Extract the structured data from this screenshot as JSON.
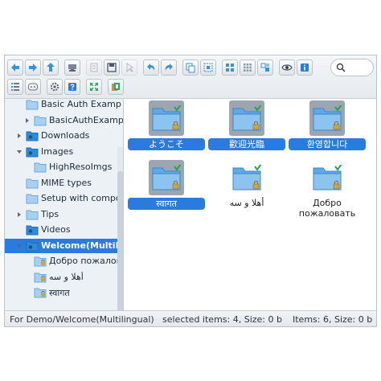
{
  "toolbar": {
    "buttons": [
      {
        "name": "back-button",
        "icon": "arrow-left-icon"
      },
      {
        "name": "forward-button",
        "icon": "arrow-right-icon"
      },
      {
        "name": "up-button",
        "icon": "arrow-up-icon"
      },
      {
        "name": "netmount-button",
        "icon": "drive-icon"
      },
      {
        "name": "open-button",
        "icon": "open-icon"
      },
      {
        "name": "save-button",
        "icon": "save-icon"
      },
      {
        "name": "select-button",
        "icon": "cursor-icon"
      },
      {
        "name": "undo-button",
        "icon": "undo-icon"
      },
      {
        "name": "redo-button",
        "icon": "redo-icon"
      },
      {
        "name": "copy-button",
        "icon": "copy-icon"
      },
      {
        "name": "select-all-button",
        "icon": "select-all-icon"
      },
      {
        "name": "view-icons-button",
        "icon": "grid-large-icon"
      },
      {
        "name": "view-small-icons-button",
        "icon": "grid-small-icon"
      },
      {
        "name": "view-tiles-button",
        "icon": "tiles-icon"
      },
      {
        "name": "preview-button",
        "icon": "eye-icon"
      },
      {
        "name": "info-button",
        "icon": "info-icon"
      },
      {
        "name": "view-list-button",
        "icon": "list-icon"
      },
      {
        "name": "sort-button",
        "icon": "sort-icon"
      },
      {
        "name": "settings-button",
        "icon": "gear-icon"
      },
      {
        "name": "help-button",
        "icon": "help-icon"
      },
      {
        "name": "fullscreen-button",
        "icon": "fullscreen-icon"
      },
      {
        "name": "extract-button",
        "icon": "archive-icon"
      }
    ],
    "search": {
      "value": "",
      "placeholder": ""
    }
  },
  "tree": {
    "items": [
      {
        "label": "Basic Auth Examp",
        "indent": 1,
        "arrow": "none",
        "icon": "folder-icon"
      },
      {
        "label": "BasicAuthExamp",
        "indent": 2,
        "arrow": "right",
        "icon": "folder-icon"
      },
      {
        "label": "Downloads",
        "indent": 1,
        "arrow": "right",
        "icon": "folder-dark-icon"
      },
      {
        "label": "Images",
        "indent": 1,
        "arrow": "down",
        "icon": "folder-dark-icon"
      },
      {
        "label": "HighResoImgs",
        "indent": 2,
        "arrow": "none",
        "icon": "folder-icon"
      },
      {
        "label": "MIME types",
        "indent": 1,
        "arrow": "none",
        "icon": "folder-icon"
      },
      {
        "label": "Setup with compo",
        "indent": 1,
        "arrow": "none",
        "icon": "folder-icon"
      },
      {
        "label": "Tips",
        "indent": 1,
        "arrow": "right",
        "icon": "folder-icon"
      },
      {
        "label": "Videos",
        "indent": 1,
        "arrow": "none",
        "icon": "folder-dark-icon"
      },
      {
        "label": "Welcome(Multilingu",
        "indent": 1,
        "arrow": "down",
        "icon": "folder-dark-icon",
        "selected": true
      },
      {
        "label": "Добро пожалова",
        "indent": 2,
        "arrow": "none",
        "icon": "folder-locked-icon"
      },
      {
        "label": "أهلا و سه",
        "indent": 2,
        "arrow": "none",
        "icon": "folder-locked-icon"
      },
      {
        "label": "स्वागत",
        "indent": 2,
        "arrow": "none",
        "icon": "folder-locked-icon"
      }
    ]
  },
  "files": [
    {
      "label": "ようこそ",
      "selected": true
    },
    {
      "label": "歡迎光臨",
      "selected": true
    },
    {
      "label": "환영합니다",
      "selected": true
    },
    {
      "label": "स्वागत",
      "selected": true
    },
    {
      "label": "أهلا و سه",
      "selected": false
    },
    {
      "label": "Добро пожаловать",
      "selected": false
    }
  ],
  "status": {
    "path": "For Demo/Welcome(Multilingual)",
    "selected": "selected items: 4, Size: 0 b",
    "items": "Items: 6, Size: 0 b"
  },
  "colors": {
    "accent": "#2a7be0",
    "folder_blue": "#5ea9e6",
    "tree_bg": "#ecf1f6"
  }
}
